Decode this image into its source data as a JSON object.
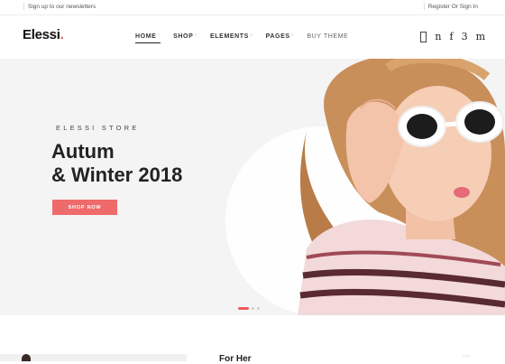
{
  "topbar": {
    "newsletter_label": "Sign up to our newsletters",
    "auth_label": "Register Or Sign In"
  },
  "brand": {
    "name": "Elessi",
    "dot": ".",
    "accent": "#ef5b5b"
  },
  "nav": {
    "items": [
      {
        "label": "HOME",
        "active": true
      },
      {
        "label": "SHOP"
      },
      {
        "label": "ELEMENTS"
      },
      {
        "label": "PAGES"
      },
      {
        "label": "BUY THEME"
      }
    ]
  },
  "header_icons": {
    "glyph1": "n",
    "glyph2": "f",
    "glyph3": "3",
    "glyph4": "m"
  },
  "hero": {
    "kicker": "ELESSI STORE",
    "title_line1": "Autum",
    "title_line2": "& Winter 2018",
    "button_label": "SHOP NOW",
    "slides": 3,
    "active_slide": 1
  },
  "below": {
    "heading": "For Her",
    "mark": "“”"
  }
}
